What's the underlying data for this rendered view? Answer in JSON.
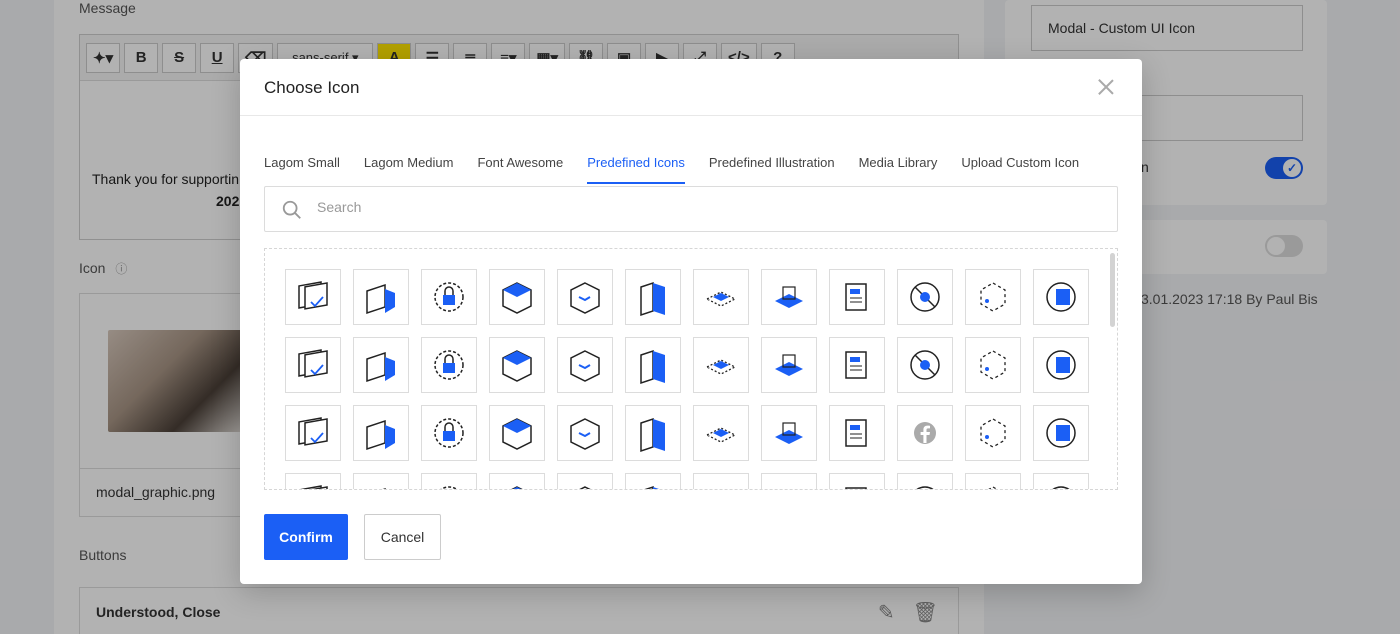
{
  "background": {
    "message_label": "Message",
    "toolbar": {
      "bold": "B",
      "strike": "S",
      "underline": "U",
      "font": "sans-serif ▾",
      "color": "A",
      "help": "?"
    },
    "editor_text": "Thank you for supportin",
    "editor_year": "202",
    "icon_label": "Icon",
    "icon_info": "ⓘ",
    "file_name": "modal_graphic.png",
    "buttons_label": "Buttons",
    "button_item": "Understood, Close",
    "edit_icon": "✎",
    "trash_icon": "🗑",
    "right_input_value": "Modal - Custom UI Icon",
    "right_partial_text": "n",
    "meta": "3.01.2023 17:18 By Paul Bis"
  },
  "modal": {
    "title": "Choose Icon",
    "tabs": [
      {
        "label": "Lagom Small",
        "active": false
      },
      {
        "label": "Lagom Medium",
        "active": false
      },
      {
        "label": "Font Awesome",
        "active": false
      },
      {
        "label": "Predefined Icons",
        "active": true
      },
      {
        "label": "Predefined Illustration",
        "active": false
      },
      {
        "label": "Media Library",
        "active": false
      },
      {
        "label": "Upload Custom Icon",
        "active": false
      }
    ],
    "search_placeholder": "Search",
    "confirm_label": "Confirm",
    "cancel_label": "Cancel",
    "icons": [
      "cards-check-icon",
      "folder-shield-icon",
      "lock-refresh-icon",
      "box-cube-icon",
      "box-arrow-icon",
      "book-open-icon",
      "layers-plane-icon",
      "server-boxes-icon",
      "document-news-icon",
      "bug-blocked-icon",
      "dashed-hexagon-icon",
      "document-refresh-icon",
      "network-arrows-icon",
      "cloud-platform-icon",
      "disk-sync-icon",
      "box-shield-icon",
      "chat-bubbles-icon",
      "building-blocks-icon",
      "globe-target-icon",
      "cloud-stack-icon",
      "panels-play-icon",
      "chart-seo-icon",
      "credit-card-icon",
      "bug-dashed-icon",
      "platform-card-icon",
      "sphere-dot-icon",
      "lock-dashed-icon",
      "cube-arrow-icon",
      "tools-cross-icon",
      "package-corner-icon",
      "layers-up-icon",
      "hexagon-layers-icon",
      "refresh-shield-icon",
      "facebook-icon",
      "hexagon-refresh-icon",
      "fire-shield-icon",
      "partial-icon-1",
      "partial-icon-2",
      "partial-icon-3",
      "partial-icon-4",
      "partial-icon-5",
      "partial-icon-6",
      "partial-icon-7",
      "partial-icon-8",
      "partial-icon-9",
      "partial-icon-10",
      "partial-icon-11",
      "partial-icon-12"
    ],
    "colors": {
      "accent": "#1b5ff5",
      "icon_stroke": "#222222"
    }
  }
}
